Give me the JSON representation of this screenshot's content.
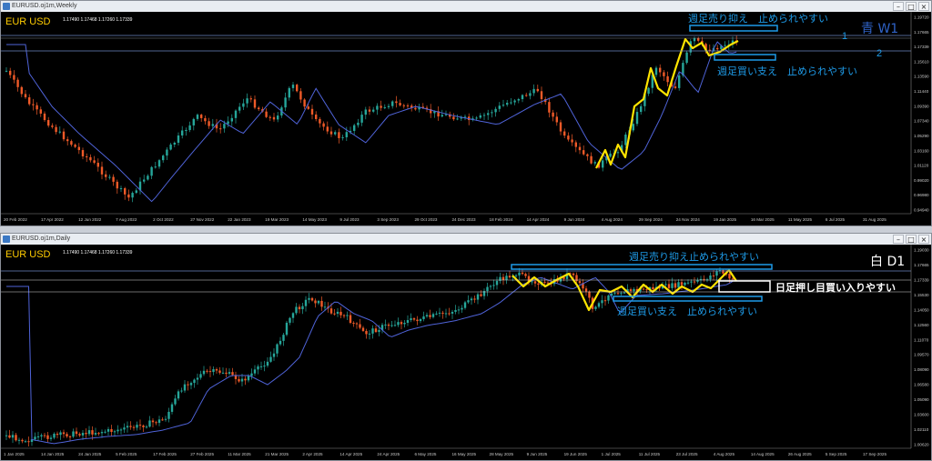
{
  "top": {
    "title": "EURUSD.oj1m,Weekly",
    "symbol": "EUR USD",
    "ohlc": "1.17490 1.17468 1.17260 1.17339",
    "timeframe_label": "青 W1",
    "annotation_resist": "週足売り抑え　止められやすい",
    "annotation_support": "週足買い支え　止められやすい",
    "line1_label": "1",
    "line2_label": "2",
    "price_labels": [
      "1.19720",
      "1.17665",
      "1.17339",
      "1.15610",
      "1.13590",
      "1.11440",
      "1.09390",
      "1.07340",
      "1.05290",
      "1.03160",
      "1.01120",
      "0.99020",
      "0.96980",
      "0.94940"
    ],
    "date_labels": [
      "20 Feb 2022",
      "17 Apr 2022",
      "12 Jun 2022",
      "7 Aug 2022",
      "2 Oct 2022",
      "27 Nov 2022",
      "22 Jan 2023",
      "19 Mar 2023",
      "14 May 2023",
      "9 Jul 2023",
      "3 Sep 2023",
      "29 Oct 2023",
      "24 Dec 2023",
      "18 Feb 2024",
      "14 Apr 2024",
      "9 Jun 2024",
      "4 Aug 2024",
      "29 Sep 2024",
      "24 Nov 2024",
      "19 Jan 2025",
      "16 Mar 2025",
      "11 May 2025",
      "6 Jul 2025",
      "31 Aug 2025"
    ]
  },
  "bottom": {
    "title": "EURUSD.oj1m,Daily",
    "symbol": "EUR USD",
    "ohlc": "1.17490 1.17468 1.17260 1.17339",
    "timeframe_label": "白 D1",
    "annotation_resist": "週足売り抑え止められやすい",
    "annotation_support": "週足買い支え　止められやすい",
    "annotation_daily": "日足押し目買い入りやすい",
    "price_labels": [
      "1.19030",
      "1.17665",
      "1.17339",
      "1.15530",
      "1.14050",
      "1.12560",
      "1.11070",
      "1.09570",
      "1.08090",
      "1.06580",
      "1.05090",
      "1.03600",
      "1.02110",
      "1.00620"
    ],
    "date_labels": [
      "1 Jan 2025",
      "14 Jan 2025",
      "24 Jan 2025",
      "5 Feb 2025",
      "17 Feb 2025",
      "27 Feb 2025",
      "11 Mar 2025",
      "21 Mar 2025",
      "2 Apr 2025",
      "14 Apr 2025",
      "24 Apr 2025",
      "6 May 2025",
      "16 May 2025",
      "28 May 2025",
      "9 Jun 2025",
      "19 Jun 2025",
      "1 Jul 2025",
      "11 Jul 2025",
      "23 Jul 2025",
      "4 Aug 2025",
      "14 Aug 2025",
      "26 Aug 2025",
      "5 Sep 2025",
      "17 Sep 2025"
    ]
  },
  "window_buttons": {
    "minimize": "–",
    "maximize": "□",
    "close": "×"
  },
  "colors": {
    "bull": "#26a69a",
    "bear": "#ef5a28",
    "ma": "#4f63d8",
    "zigzag": "#ffe400",
    "annotation": "#1e9be8",
    "symbol": "#ffcc00"
  }
}
